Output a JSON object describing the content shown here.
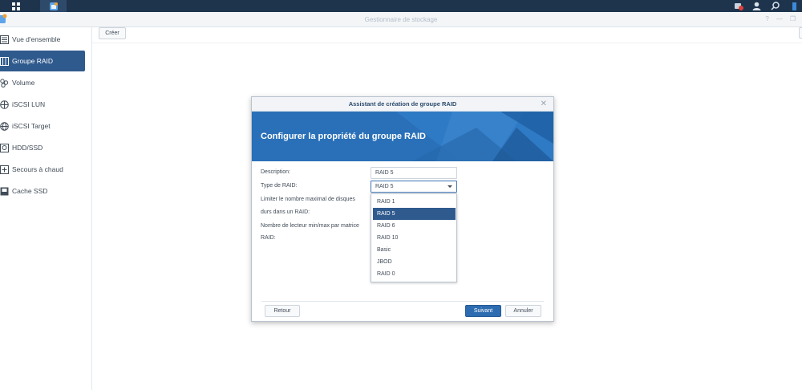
{
  "window": {
    "title": "Gestionnaire de stockage"
  },
  "sidebar": {
    "items": [
      {
        "label": "Vue d'ensemble",
        "icon": "overview-icon"
      },
      {
        "label": "Groupe RAID",
        "icon": "raid-icon",
        "active": true
      },
      {
        "label": "Volume",
        "icon": "volume-icon"
      },
      {
        "label": "iSCSI LUN",
        "icon": "lun-icon"
      },
      {
        "label": "iSCSI Target",
        "icon": "target-icon"
      },
      {
        "label": "HDD/SSD",
        "icon": "hdd-icon"
      },
      {
        "label": "Secours à chaud",
        "icon": "hot-spare-icon"
      },
      {
        "label": "Cache SSD",
        "icon": "ssd-cache-icon"
      }
    ]
  },
  "toolbar": {
    "create_label": "Créer"
  },
  "dialog": {
    "title": "Assistant de création de groupe RAID",
    "banner_title": "Configurer la propriété du groupe RAID",
    "labels": {
      "description": "Description:",
      "raid_type": "Type de RAID:",
      "limit_line1": "Limiter le nombre maximal de disques",
      "limit_line2": "durs dans un RAID:",
      "minmax_line1": "Nombre de lecteur min/max par matrice",
      "minmax_line2": "RAID:"
    },
    "description_value": "RAID 5",
    "raid_type_value": "RAID 5",
    "raid_options": [
      "RAID 1",
      "RAID 5",
      "RAID 6",
      "RAID 10",
      "Basic",
      "JBOD",
      "RAID 0"
    ],
    "selected_option": "RAID 5",
    "buttons": {
      "back": "Retour",
      "next": "Suivant",
      "cancel": "Annuler"
    }
  },
  "colors": {
    "accent": "#2f5a8e",
    "banner": "#2a70b8",
    "taskbar": "#1e344d"
  }
}
